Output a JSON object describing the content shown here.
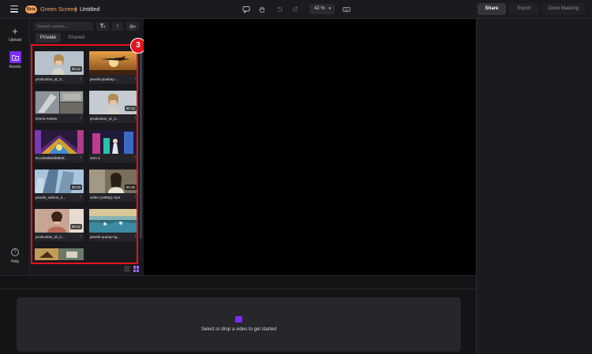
{
  "header": {
    "badge": "Beta",
    "app_name": "Green Screen",
    "separator": "|",
    "doc_title": "Untitled",
    "zoom": "42 %",
    "share_label": "Share",
    "export_label": "Export",
    "done_label": "Done Masking"
  },
  "rail": {
    "upload_label": "Upload",
    "assets_label": "Assets",
    "help_label": "Help"
  },
  "panel": {
    "search_placeholder": "Search assets...",
    "tab_private": "Private",
    "tab_shared": "Shared",
    "assets": [
      {
        "name": "production_id_3...",
        "duration": "00:12"
      },
      {
        "name": "pexels-pixabay-...",
        "duration": ""
      },
      {
        "name": "Demo Assets",
        "duration": ""
      },
      {
        "name": "production_id_3...",
        "duration": "00:12"
      },
      {
        "name": "8ccd29d5dd68b0f...",
        "duration": ""
      },
      {
        "name": "Gen-1",
        "duration": ""
      },
      {
        "name": "pexels_videos_2...",
        "duration": "00:10"
      },
      {
        "name": "video (1080p).mp4",
        "duration": "00:15"
      },
      {
        "name": "production_id_3...",
        "duration": "00:22"
      },
      {
        "name": "pexels-quang-ng...",
        "duration": ""
      }
    ]
  },
  "annotation": {
    "step": "3"
  },
  "dropzone": {
    "text": "Select or drop a video to get started"
  },
  "colors": {
    "accent": "#7b2cf5",
    "highlight": "#e3141e",
    "brand": "#f2a05a"
  }
}
